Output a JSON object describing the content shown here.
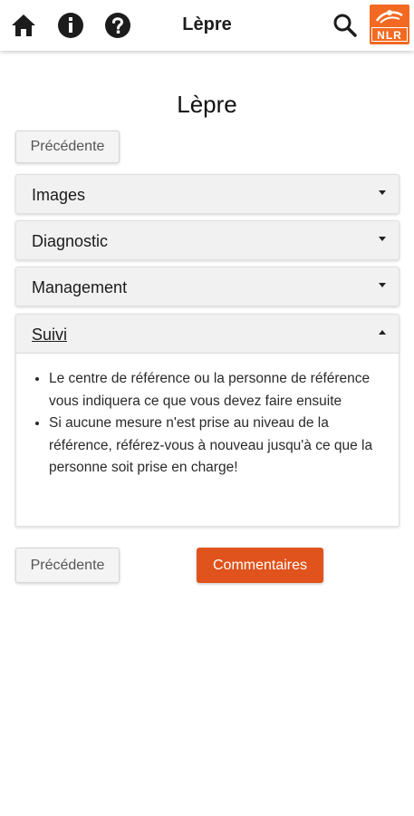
{
  "header": {
    "title": "Lèpre",
    "home_icon": "home-icon",
    "info_icon": "info-icon",
    "help_icon": "help-icon",
    "search_icon": "search-icon",
    "logo_text": "NLR",
    "logo_color": "#f26a21"
  },
  "page": {
    "title": "Lèpre",
    "prev_label_top": "Précédente",
    "prev_label_bottom": "Précédente",
    "comments_label": "Commentaires",
    "accent_color": "#e0531c"
  },
  "accordion": [
    {
      "label": "Images",
      "expanded": false
    },
    {
      "label": "Diagnostic",
      "expanded": false
    },
    {
      "label": "Management",
      "expanded": false
    },
    {
      "label": "Suivi",
      "expanded": true,
      "items": [
        "Le centre de référence ou la personne de référence vous indiquera ce que vous devez faire ensuite",
        "Si aucune mesure n'est prise au niveau de la référence, référez-vous à nouveau jusqu'à ce que la personne soit prise en charge!"
      ]
    }
  ]
}
